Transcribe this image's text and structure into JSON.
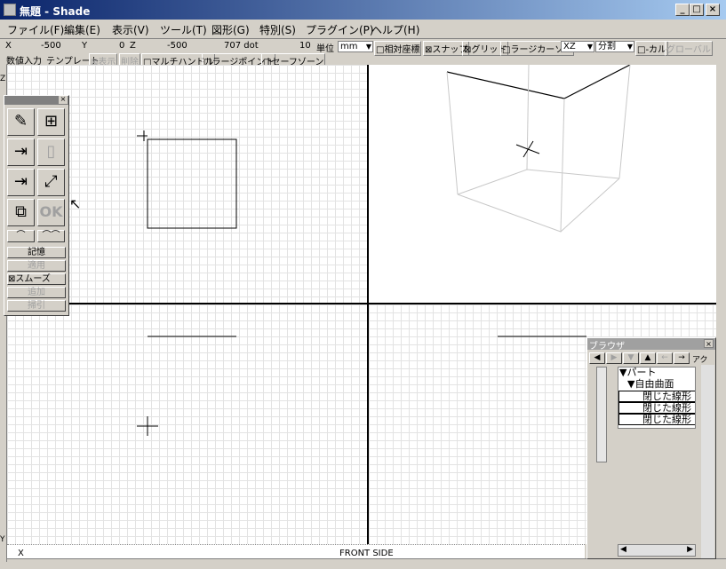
{
  "window": {
    "title": "無題 - Shade",
    "minimize": "_",
    "maximize": "□",
    "close": "×"
  },
  "menu": [
    "ファイル(F)",
    "編集(E)",
    "表示(V)",
    "ツール(T)",
    "図形(G)",
    "特別(S)",
    "プラグイン(P)",
    "ヘルプ(H)"
  ],
  "status": {
    "x_label": "X",
    "x_value": "-500",
    "y_label": "Y",
    "y_value": "0",
    "z_label": "Z",
    "z_value": "-500",
    "size_value": "707 dot",
    "units_count": "10",
    "units_label": "単位",
    "units_select": "mm",
    "relative_coords": "□相対座標",
    "snap": "⊠スナップ",
    "grid": "⊠グリッド",
    "large_cursor": "□ラージカーソル",
    "plane_select": "XZ",
    "split_select": "分割",
    "local": "□-カル",
    "global": "グローバル"
  },
  "toolbar2": {
    "numeric_input": "数値入力",
    "template": "テンプレート",
    "show": "⊠表示",
    "delete": "削除",
    "multi_handle": "□マルチハンドル",
    "large_point": "□ラージポイント",
    "safe_zone": "□セーフゾーン"
  },
  "rulers": {
    "top_left_axis": "Z",
    "bottom_axis_y": "Y",
    "bottom_axis_x": "X",
    "view_label": "FRONT SIDE"
  },
  "palette": {
    "close": "×",
    "memory": "記憶",
    "apply": "適用",
    "smooth": "⊠スムーズ",
    "add": "追加",
    "sweep": "掃引",
    "ok_glyph": "OK"
  },
  "browser": {
    "title": "ブラウザ",
    "close": "×",
    "nav_tail": "アク",
    "tree": [
      "▼パート",
      "▼自由曲面",
      "閉じた線形",
      "閉じた線形",
      "閉じた線形"
    ]
  },
  "icons": [
    "pencil-icon",
    "hierarchy-icon",
    "move-icon",
    "cylinder-icon",
    "scale-icon",
    "path-icon",
    "copy-icon",
    "ok-icon",
    "cursor-icon"
  ]
}
